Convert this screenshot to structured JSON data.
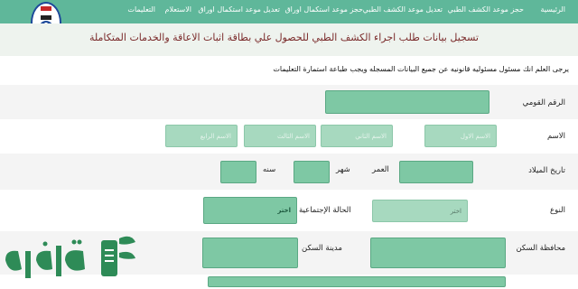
{
  "nav": {
    "items": [
      {
        "label": "الرئيسية"
      },
      {
        "label": "حجز موعد الكشف الطبي"
      },
      {
        "label": "تعديل موعد الكشف الطبي"
      },
      {
        "label": "حجز موعد استكمال اوراق"
      },
      {
        "label": "تعديل موعد استكمال اوراق"
      },
      {
        "label": "الاستعلام"
      },
      {
        "label": "التعليمات"
      }
    ]
  },
  "header": {
    "title": "تسجيل بيانات طلب اجراء الكشف الطبي للحصول علي بطاقة اثبات الاعاقة والخدمات المتكاملة"
  },
  "notice": "يرجى العلم انك مسئول مسئوليه قانونيه عن جميع البيانات المسجله ويجب طباعة استمارة التعليمات",
  "form": {
    "national_id_label": "الرقم القومي",
    "name_label": "الاسم",
    "name_placeholders": {
      "first": "الاسم الاول",
      "second": "الاسم الثاني",
      "third": "الاسم الثالث",
      "fourth": "الاسم الرابع"
    },
    "birth_label": "تاريخ الميلاد",
    "age_label": "العمر",
    "month_label": "شهر",
    "year_label": "سنه",
    "gender_label": "النوع",
    "gender_value": "اختر",
    "marital_label": "الحالة الإجتماعية",
    "marital_value": "اختر",
    "governorate_label": "محافظة السكن",
    "city_label": "مدينة السكن"
  },
  "colors": {
    "nav_bg": "#5fb79a",
    "field_bg": "#7ec8a4",
    "header_title": "#7a2a2a"
  }
}
